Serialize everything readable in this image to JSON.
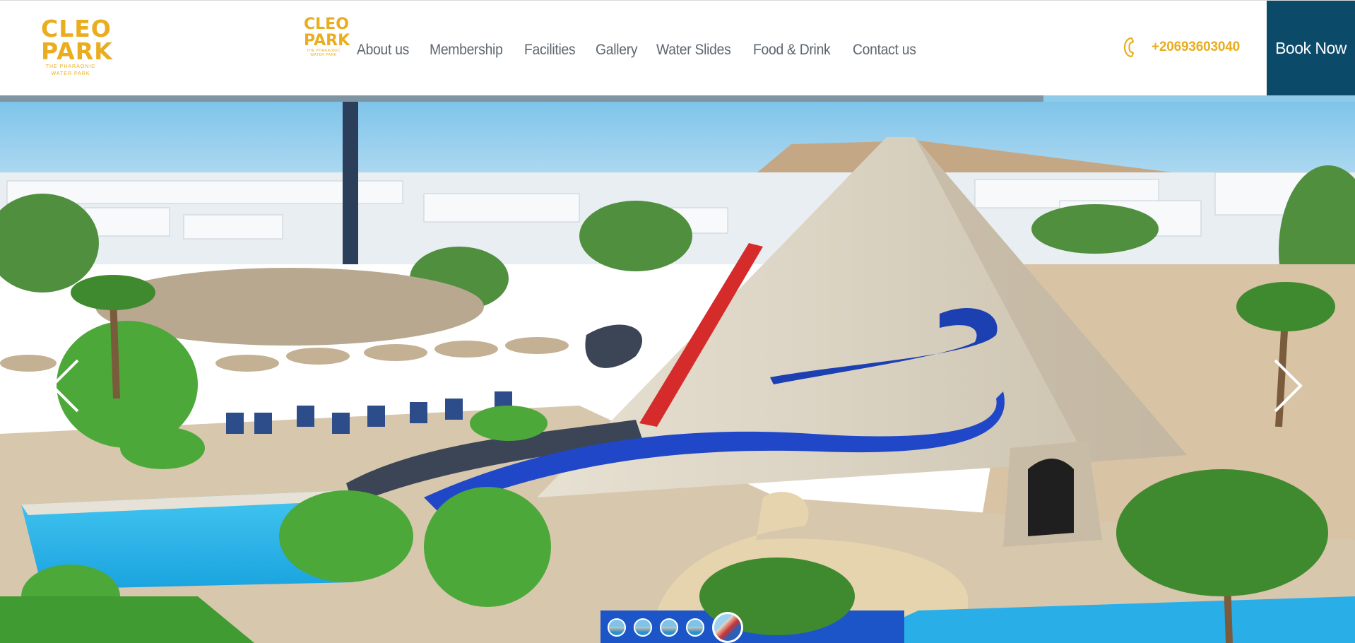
{
  "brand": {
    "logo_line1": "CLEO",
    "logo_line2": "PARK",
    "tagline_line1": "THE PHARAONIC",
    "tagline_line2": "WATER PARK",
    "color": "#e9ad1f"
  },
  "nav": {
    "items": [
      {
        "label": "About us"
      },
      {
        "label": "Membership"
      },
      {
        "label": "Facilities"
      },
      {
        "label": "Gallery"
      },
      {
        "label": "Water Slides"
      },
      {
        "label": "Food & Drink"
      },
      {
        "label": "Contact us"
      }
    ]
  },
  "contact": {
    "phone": "+20693603040",
    "icon": "phone-icon"
  },
  "book_button": {
    "label": "Book Now",
    "color": "#0c4a6a"
  },
  "slider": {
    "progress_percent": 77,
    "prev_icon": "chevron-left-icon",
    "next_icon": "chevron-right-icon",
    "slide_count": 5,
    "active_slide": 5
  }
}
